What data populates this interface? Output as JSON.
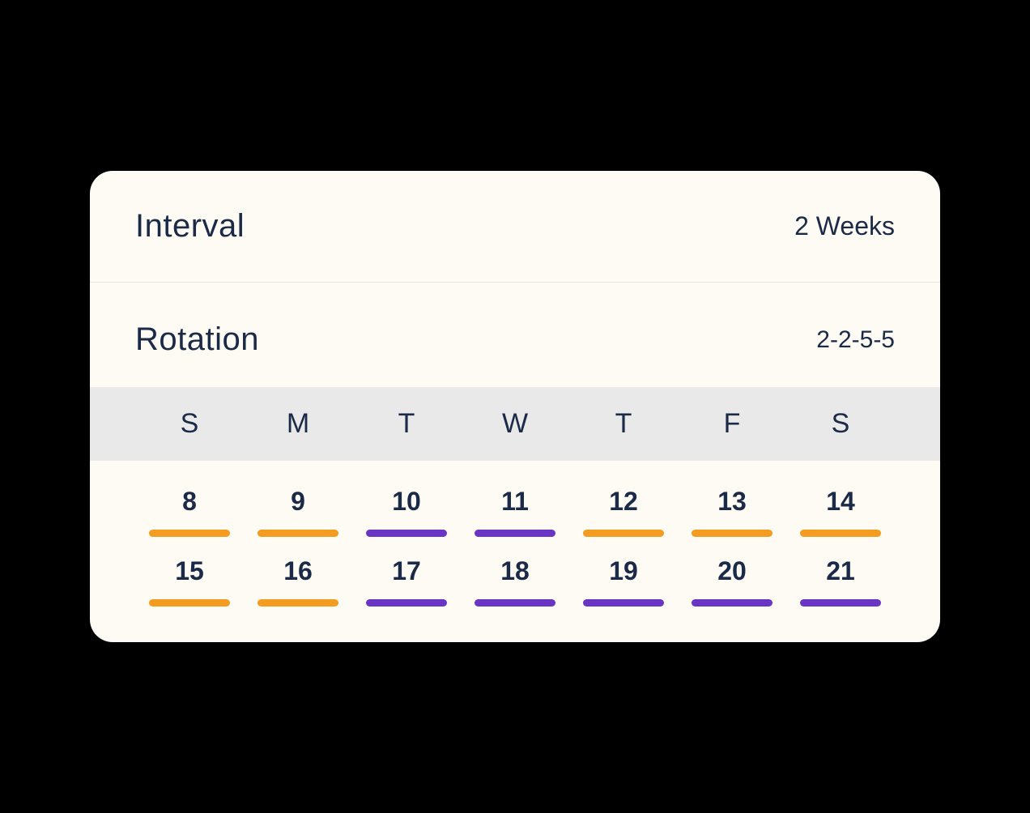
{
  "interval": {
    "label": "Interval",
    "value": "2 Weeks"
  },
  "rotation": {
    "label": "Rotation",
    "value": "2-2-5-5"
  },
  "dayHeaders": [
    "S",
    "M",
    "T",
    "W",
    "T",
    "F",
    "S"
  ],
  "weeks": [
    [
      {
        "num": "8",
        "color": "orange"
      },
      {
        "num": "9",
        "color": "orange"
      },
      {
        "num": "10",
        "color": "purple"
      },
      {
        "num": "11",
        "color": "purple"
      },
      {
        "num": "12",
        "color": "orange"
      },
      {
        "num": "13",
        "color": "orange"
      },
      {
        "num": "14",
        "color": "orange"
      }
    ],
    [
      {
        "num": "15",
        "color": "orange"
      },
      {
        "num": "16",
        "color": "orange"
      },
      {
        "num": "17",
        "color": "purple"
      },
      {
        "num": "18",
        "color": "purple"
      },
      {
        "num": "19",
        "color": "purple"
      },
      {
        "num": "20",
        "color": "purple"
      },
      {
        "num": "21",
        "color": "purple"
      }
    ]
  ],
  "colors": {
    "orange": "#f39c1f",
    "purple": "#6a35c4"
  }
}
